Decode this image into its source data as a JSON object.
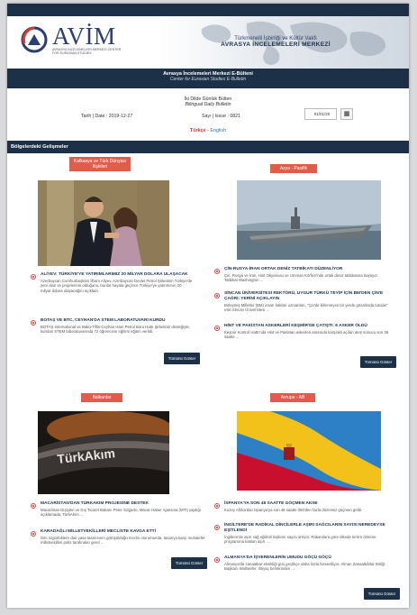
{
  "header": {
    "logo_title": "AVİM",
    "logo_subtitle": "AVRASYA İNCELEMELERİ MERKEZİ CENTER FOR EURASIAN STUDIES",
    "brand_line1": "Türkmenelli İşbirliği ve Kültür Vakfı",
    "brand_line2": "AVRASYA İNCELEMELERİ MERKEZİ"
  },
  "bulletin": {
    "title": "Avrasya İncelemeleri Merkezi E-Bülteni",
    "subtitle": "Center for Eurasian Studies E-Bulletin",
    "line1": "İki Dilde Günlük Bülten",
    "line2": "Bilingual Daily Bulletin",
    "date_label": "Tarih | Date : 2019-12-27",
    "issue_label": "Sayı | Issue : 0821",
    "date_value": "01/01/20",
    "calendar_icon": "calendar-icon",
    "lang_tr": "Türkçe",
    "lang_sep": " - ",
    "lang_en": "English"
  },
  "section_title": "Bölgelerdeki Gelişmeler",
  "more_label": "Tümünü Göster",
  "regions": {
    "caucasus": {
      "label": "Kafkasya ve Türk Dünyası İlişkileri",
      "articles": [
        {
          "title": "ALİYEV: TÜRKİYE'YE YATIRIMLARIMIZ 20 MİLYAR DOLARA ULAŞACAK",
          "desc": "Azerbaycan Cumhurbaşkanı İlham Aliyev, Azerbaycan Devlet Petrol Şirketinin Türkiye'de yeni olan ve projelerinin olduğunu, bunlar hayata geçince Türkiye'ye yatırımının 20 milyar dolara ulaşacağını açıkladı."
        },
        {
          "title": "BOTAŞ VE BTC, CEYHAN'DA STEM LABORATUVARI KURDU",
          "desc": "BOTAŞ International ve Bakü-Tiflis-Ceyhan Ham Petrol Boru Hattı Şirketinin desteğiyle, kurulan STEM laboratuvarında 72 öğrencinin eğitimi eğitim verildi."
        }
      ]
    },
    "asia": {
      "label": "Asya - Pasifik",
      "articles": [
        {
          "title": "ÇİN-RUSYA-İRAN ORTAK DENİZ TATBİKATI DÜZENLİYOR",
          "desc": "Çin, Rusya ve İran, Hint Okyanusu ve Umman Körfezi'nde ortak deniz tatbikatına başlıyor. Tatbikat Washington ..."
        },
        {
          "title": "SİNCAN ÜNİVERSİTESİ REKTÖRÜ, UYGUR TÜRKÜ TEYİP İÇİN BM'DEN ÇİN'E ÇAĞRI: YERİNİ AÇIKLAYIN",
          "desc": "Birleşmiş Milletler (BM) insan hakları uzmanları, \"Çin'de bilinmeyen bir yerde gözaltında tutulan\" eski Sincan Üniversitesi ..."
        },
        {
          "title": "HİNT VE PAKİSTAN ASKERLERİ KEŞMİR'DE ÇATIŞTI: 6 ASKER ÖLDÜ",
          "desc": "Keşmir Kontrol Hattı'nda Hint ve Pakistan askerleri arasında karşılıklı açılan ateş sonucu son 36 saatte ..."
        }
      ]
    },
    "balkans": {
      "label": "Balkanlar",
      "articles": [
        {
          "title": "MACARİSTAN'DAN TÜRKAKIM PROJESİNE DESTEK",
          "desc": "Macaristan Dışişleri ve Dış Ticaret Bakanı Peter Szijjarto, Macar Haber Ajansına (MTI) yaptığı açıklamada, TürkAkım ..."
        },
        {
          "title": "KARADAĞLI MİLLETVEKİLLERİ MECLİSTE KAVGA ETTİ",
          "desc": "Dini özgürlüklere dair yasa tasarısının görüşüldüğü meclis oturumunda, tasarıya karşı muhalefet milletvekilleri polis tarafından gerel ..."
        }
      ]
    },
    "europe": {
      "label": "Avrupa - AB",
      "articles": [
        {
          "title": "İSPANYA'YA SON 48 SAATTE GÖÇMEN AKINI",
          "desc": "Kuzey Afrika'dan İspanya'ya son 48 saatte 350'den fazla düzensiz göçmen geldi."
        },
        {
          "title": "İNGİLTERE'DE RADİKAL DİNCİLERLE AŞIRI SAĞCILARIN SAYISI NEREDEYSE EŞİTLENDİ",
          "desc": "İngiltere'de aşırı sağ eğilimli kişilerin sayısı artıyor. Rakamlara göre ülkede terörü önleme programına katılan aşırı ..."
        },
        {
          "title": "ALMANYA'DA İŞVERENLERİN UMUDU GÖÇÜ GÖÇÜ",
          "desc": "Almanya'da zanaatkar eksikliği gün geçtikçe daha fazla hissediliyor. Alman Zanaatkârlar Birliği Başkanı Wollseifer, ihtiyaç belirtirinden ..."
        }
      ]
    }
  }
}
